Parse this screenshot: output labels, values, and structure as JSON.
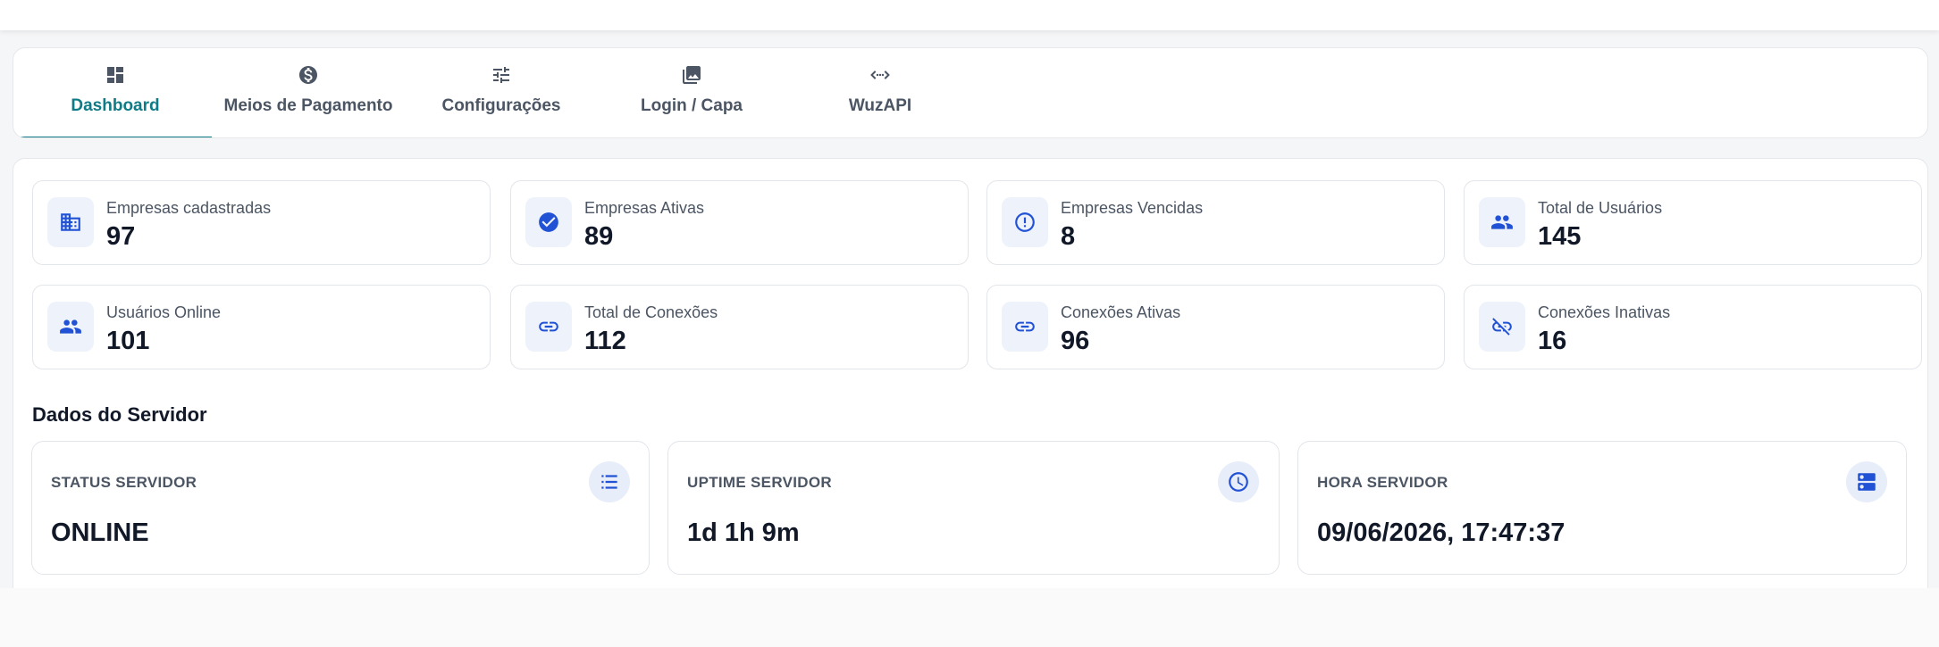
{
  "tabs": [
    {
      "label": "Dashboard",
      "icon": "dashboard-icon",
      "active": true
    },
    {
      "label": "Meios de Pagamento",
      "icon": "dollar-circle-icon",
      "active": false
    },
    {
      "label": "Configurações",
      "icon": "tune-icon",
      "active": false
    },
    {
      "label": "Login / Capa",
      "icon": "image-icon",
      "active": false
    },
    {
      "label": "WuzAPI",
      "icon": "code-arrows-icon",
      "active": false
    }
  ],
  "stats": [
    {
      "label": "Empresas cadastradas",
      "value": "97",
      "icon": "building-icon"
    },
    {
      "label": "Empresas Ativas",
      "value": "89",
      "icon": "check-circle-icon"
    },
    {
      "label": "Empresas Vencidas",
      "value": "8",
      "icon": "alert-circle-icon"
    },
    {
      "label": "Total de Usuários",
      "value": "145",
      "icon": "people-icon"
    },
    {
      "label": "Usuários Online",
      "value": "101",
      "icon": "people-icon"
    },
    {
      "label": "Total de Conexões",
      "value": "112",
      "icon": "link-icon"
    },
    {
      "label": "Conexões Ativas",
      "value": "96",
      "icon": "link-icon"
    },
    {
      "label": "Conexões Inativas",
      "value": "16",
      "icon": "link-off-icon"
    }
  ],
  "server": {
    "title": "Dados do Servidor",
    "cards": [
      {
        "label": "STATUS SERVIDOR",
        "value": "ONLINE",
        "icon": "list-icon"
      },
      {
        "label": "UPTIME SERVIDOR",
        "value": "1d 1h 9m",
        "icon": "clock-icon"
      },
      {
        "label": "HORA SERVIDOR",
        "value": "09/06/2026, 17:47:37",
        "icon": "server-icon"
      }
    ]
  },
  "colors": {
    "accent": "#0f7b86",
    "icon_blue": "#2152d6",
    "icon_bg": "#eef2fb"
  }
}
